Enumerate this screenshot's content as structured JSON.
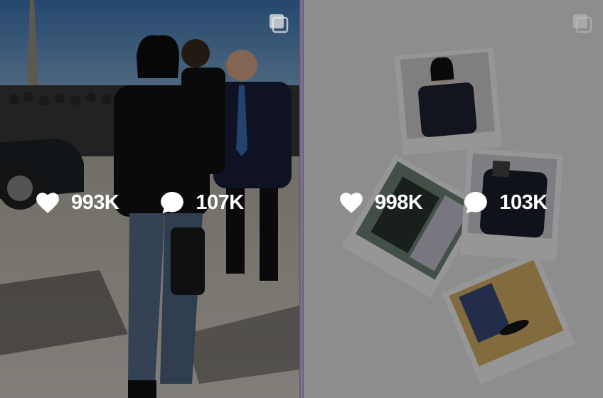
{
  "posts": [
    {
      "likes": "993K",
      "comments": "107K",
      "type_icon": "multi-photo-icon"
    },
    {
      "likes": "998K",
      "comments": "103K",
      "type_icon": "multi-photo-icon"
    }
  ],
  "colors": {
    "overlay": "rgba(0,0,0,0.40)",
    "stat_text": "#ffffff"
  }
}
